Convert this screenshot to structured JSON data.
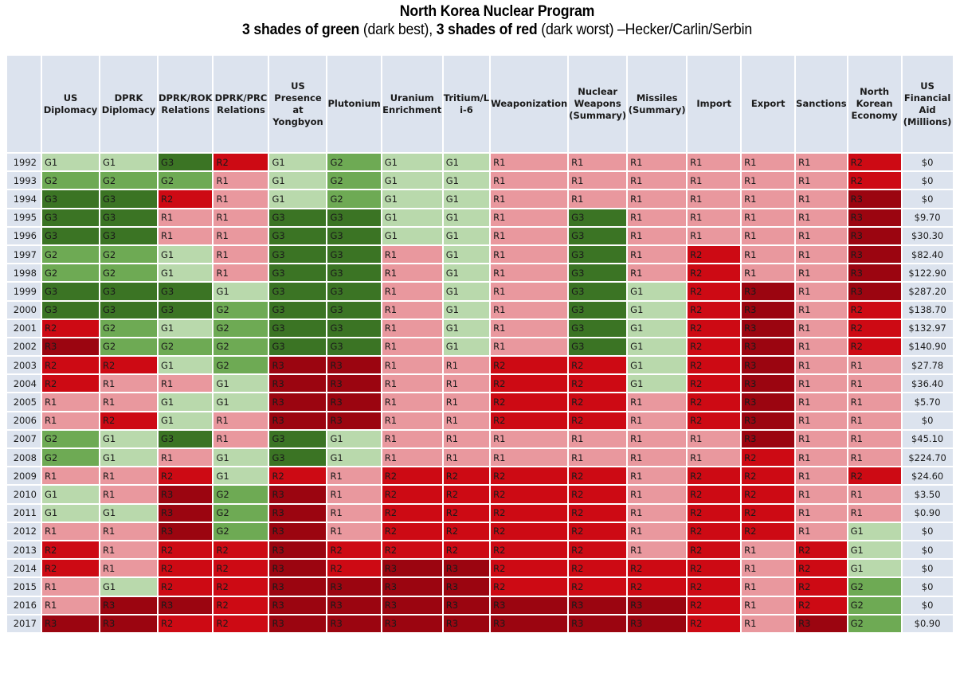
{
  "title": {
    "line1": "North Korea Nuclear Program",
    "line2_green_bold": "3 shades of green",
    "line2_green_note": " (dark best), ",
    "line2_red_bold": "3 shades of red",
    "line2_red_note": " (dark worst) –Hecker/Carlin/Serbin"
  },
  "legend_colors": {
    "G1": "#b9d9ac",
    "G2": "#6eaa54",
    "G3": "#3b7424",
    "R1": "#e9989e",
    "R2": "#cd0a14",
    "R3": "#9b0510",
    "header_bg": "#dce3ee"
  },
  "chart_data": {
    "type": "table",
    "title": "North Korea Nuclear Program",
    "subtitle": "3 shades of green (dark best), 3 shades of red (dark worst) –Hecker/Carlin/Serbin",
    "columns": [
      "",
      "US Diplomacy",
      "DPRK Diplomacy",
      "DPRK/ROK Relations",
      "DPRK/PRC Relations",
      "US Presence at Yongbyon",
      "Plutonium",
      "Uranium Enrichment",
      "Tritium/Li-6",
      "Weaponization",
      "Nuclear Weapons (Summary)",
      "Missiles (Summary)",
      "Import",
      "Export",
      "Sanctions",
      "North Korean Economy",
      "US Financial Aid (Millions)"
    ],
    "column_header_lines": [
      [
        ""
      ],
      [
        "US",
        "Diplomacy"
      ],
      [
        "DPRK",
        "Diplomacy"
      ],
      [
        "DPRK/ROK",
        "Relations"
      ],
      [
        "DPRK/PRC",
        "Relations"
      ],
      [
        "US",
        "Presence at",
        "Yongbyon"
      ],
      [
        "Plutonium"
      ],
      [
        "Uranium",
        "Enrichment"
      ],
      [
        "Tritium/L",
        "i-6"
      ],
      [
        "Weaponization"
      ],
      [
        "Nuclear",
        "Weapons",
        "(Summary)"
      ],
      [
        "Missiles",
        "(Summary)"
      ],
      [
        "Import"
      ],
      [
        "Export"
      ],
      [
        "Sanctions"
      ],
      [
        "North",
        "Korean",
        "Economy"
      ],
      [
        "US",
        "Financial",
        "Aid",
        "(Millions)"
      ]
    ],
    "rows": [
      {
        "year": "1992",
        "ratings": [
          "G1",
          "G1",
          "G3",
          "R2",
          "G1",
          "G2",
          "G1",
          "G1",
          "R1",
          "R1",
          "R1",
          "R1",
          "R1",
          "R1",
          "R2"
        ],
        "aid": "$0"
      },
      {
        "year": "1993",
        "ratings": [
          "G2",
          "G2",
          "G2",
          "R1",
          "G1",
          "G2",
          "G1",
          "G1",
          "R1",
          "R1",
          "R1",
          "R1",
          "R1",
          "R1",
          "R2"
        ],
        "aid": "$0"
      },
      {
        "year": "1994",
        "ratings": [
          "G3",
          "G3",
          "R2",
          "R1",
          "G1",
          "G2",
          "G1",
          "G1",
          "R1",
          "R1",
          "R1",
          "R1",
          "R1",
          "R1",
          "R3"
        ],
        "aid": "$0"
      },
      {
        "year": "1995",
        "ratings": [
          "G3",
          "G3",
          "R1",
          "R1",
          "G3",
          "G3",
          "G1",
          "G1",
          "R1",
          "G3",
          "R1",
          "R1",
          "R1",
          "R1",
          "R3"
        ],
        "aid": "$9.70"
      },
      {
        "year": "1996",
        "ratings": [
          "G3",
          "G3",
          "R1",
          "R1",
          "G3",
          "G3",
          "G1",
          "G1",
          "R1",
          "G3",
          "R1",
          "R1",
          "R1",
          "R1",
          "R3"
        ],
        "aid": "$30.30"
      },
      {
        "year": "1997",
        "ratings": [
          "G2",
          "G2",
          "G1",
          "R1",
          "G3",
          "G3",
          "R1",
          "G1",
          "R1",
          "G3",
          "R1",
          "R2",
          "R1",
          "R1",
          "R3"
        ],
        "aid": "$82.40"
      },
      {
        "year": "1998",
        "ratings": [
          "G2",
          "G2",
          "G1",
          "R1",
          "G3",
          "G3",
          "R1",
          "G1",
          "R1",
          "G3",
          "R1",
          "R2",
          "R1",
          "R1",
          "R3"
        ],
        "aid": "$122.90"
      },
      {
        "year": "1999",
        "ratings": [
          "G3",
          "G3",
          "G3",
          "G1",
          "G3",
          "G3",
          "R1",
          "G1",
          "R1",
          "G3",
          "G1",
          "R2",
          "R3",
          "R1",
          "R3"
        ],
        "aid": "$287.20"
      },
      {
        "year": "2000",
        "ratings": [
          "G3",
          "G3",
          "G3",
          "G2",
          "G3",
          "G3",
          "R1",
          "G1",
          "R1",
          "G3",
          "G1",
          "R2",
          "R3",
          "R1",
          "R2"
        ],
        "aid": "$138.70"
      },
      {
        "year": "2001",
        "ratings": [
          "R2",
          "G2",
          "G1",
          "G2",
          "G3",
          "G3",
          "R1",
          "G1",
          "R1",
          "G3",
          "G1",
          "R2",
          "R3",
          "R1",
          "R2"
        ],
        "aid": "$132.97"
      },
      {
        "year": "2002",
        "ratings": [
          "R3",
          "G2",
          "G2",
          "G2",
          "G3",
          "G3",
          "R1",
          "G1",
          "R1",
          "G3",
          "G1",
          "R2",
          "R3",
          "R1",
          "R2"
        ],
        "aid": "$140.90"
      },
      {
        "year": "2003",
        "ratings": [
          "R2",
          "R2",
          "G1",
          "G2",
          "R3",
          "R3",
          "R1",
          "R1",
          "R2",
          "R2",
          "G1",
          "R2",
          "R3",
          "R1",
          "R1"
        ],
        "aid": "$27.78"
      },
      {
        "year": "2004",
        "ratings": [
          "R2",
          "R1",
          "R1",
          "G1",
          "R3",
          "R3",
          "R1",
          "R1",
          "R2",
          "R2",
          "G1",
          "R2",
          "R3",
          "R1",
          "R1"
        ],
        "aid": "$36.40"
      },
      {
        "year": "2005",
        "ratings": [
          "R1",
          "R1",
          "G1",
          "G1",
          "R3",
          "R3",
          "R1",
          "R1",
          "R2",
          "R2",
          "R1",
          "R2",
          "R3",
          "R1",
          "R1"
        ],
        "aid": "$5.70"
      },
      {
        "year": "2006",
        "ratings": [
          "R1",
          "R2",
          "G1",
          "R1",
          "R3",
          "R3",
          "R1",
          "R1",
          "R2",
          "R2",
          "R1",
          "R2",
          "R3",
          "R1",
          "R1"
        ],
        "aid": "$0"
      },
      {
        "year": "2007",
        "ratings": [
          "G2",
          "G1",
          "G3",
          "R1",
          "G3",
          "G1",
          "R1",
          "R1",
          "R1",
          "R1",
          "R1",
          "R1",
          "R3",
          "R1",
          "R1"
        ],
        "aid": "$45.10"
      },
      {
        "year": "2008",
        "ratings": [
          "G2",
          "G1",
          "R1",
          "G1",
          "G3",
          "G1",
          "R1",
          "R1",
          "R1",
          "R1",
          "R1",
          "R1",
          "R2",
          "R1",
          "R1"
        ],
        "aid": "$224.70"
      },
      {
        "year": "2009",
        "ratings": [
          "R1",
          "R1",
          "R2",
          "G1",
          "R2",
          "R1",
          "R2",
          "R2",
          "R2",
          "R2",
          "R1",
          "R2",
          "R2",
          "R1",
          "R2"
        ],
        "aid": "$24.60"
      },
      {
        "year": "2010",
        "ratings": [
          "G1",
          "R1",
          "R3",
          "G2",
          "R3",
          "R1",
          "R2",
          "R2",
          "R2",
          "R2",
          "R1",
          "R2",
          "R2",
          "R1",
          "R1"
        ],
        "aid": "$3.50"
      },
      {
        "year": "2011",
        "ratings": [
          "G1",
          "G1",
          "R3",
          "G2",
          "R3",
          "R1",
          "R2",
          "R2",
          "R2",
          "R2",
          "R1",
          "R2",
          "R2",
          "R1",
          "R1"
        ],
        "aid": "$0.90"
      },
      {
        "year": "2012",
        "ratings": [
          "R1",
          "R1",
          "R3",
          "G2",
          "R3",
          "R1",
          "R2",
          "R2",
          "R2",
          "R2",
          "R1",
          "R2",
          "R2",
          "R1",
          "G1"
        ],
        "aid": "$0"
      },
      {
        "year": "2013",
        "ratings": [
          "R2",
          "R1",
          "R2",
          "R2",
          "R3",
          "R2",
          "R2",
          "R2",
          "R2",
          "R2",
          "R1",
          "R2",
          "R1",
          "R2",
          "G1"
        ],
        "aid": "$0"
      },
      {
        "year": "2014",
        "ratings": [
          "R2",
          "R1",
          "R2",
          "R2",
          "R3",
          "R2",
          "R3",
          "R3",
          "R2",
          "R2",
          "R2",
          "R2",
          "R1",
          "R2",
          "G1"
        ],
        "aid": "$0"
      },
      {
        "year": "2015",
        "ratings": [
          "R1",
          "G1",
          "R2",
          "R2",
          "R3",
          "R3",
          "R3",
          "R3",
          "R2",
          "R2",
          "R2",
          "R2",
          "R1",
          "R2",
          "G2"
        ],
        "aid": "$0"
      },
      {
        "year": "2016",
        "ratings": [
          "R1",
          "R3",
          "R3",
          "R2",
          "R3",
          "R3",
          "R3",
          "R3",
          "R3",
          "R3",
          "R3",
          "R2",
          "R1",
          "R2",
          "G2"
        ],
        "aid": "$0"
      },
      {
        "year": "2017",
        "ratings": [
          "R3",
          "R3",
          "R2",
          "R2",
          "R3",
          "R3",
          "R3",
          "R3",
          "R3",
          "R3",
          "R3",
          "R2",
          "R1",
          "R3",
          "G2"
        ],
        "aid": "$0.90"
      }
    ]
  }
}
